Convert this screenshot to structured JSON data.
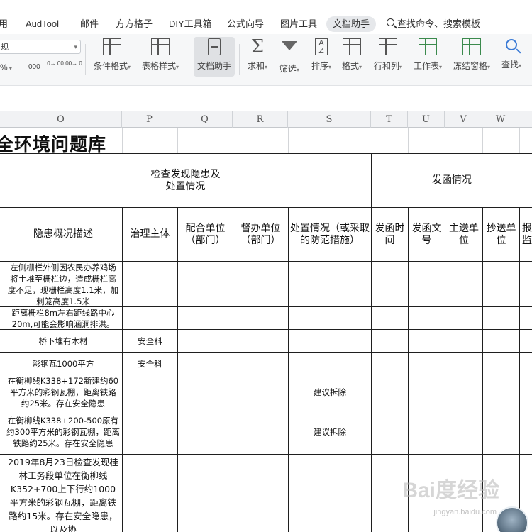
{
  "tabs": [
    {
      "label": "用",
      "x": 0
    },
    {
      "label": "AudTool"
    },
    {
      "label": "邮件"
    },
    {
      "label": "方方格子"
    },
    {
      "label": "DIY工具箱"
    },
    {
      "label": "公式向导"
    },
    {
      "label": "图片工具"
    },
    {
      "label": "文档助手",
      "active": true
    },
    {
      "label": "查找命令、搜索模板"
    }
  ],
  "toolbar": {
    "number_format_value": "规",
    "percent_label": "%",
    "thousands_label": "000",
    "inc_decimal_label": ".0→.00",
    "dec_decimal_label": ".00→.0",
    "tools": [
      {
        "label": "条件格式",
        "icon": "conditional-format-icon"
      },
      {
        "label": "表格样式",
        "icon": "table-style-icon"
      },
      {
        "label": "文档助手",
        "icon": "doc-assistant-icon",
        "active": true
      },
      {
        "label": "求和",
        "icon": "sigma-icon"
      },
      {
        "label": "筛选",
        "icon": "filter-icon"
      },
      {
        "label": "排序",
        "icon": "sort-icon"
      },
      {
        "label": "格式",
        "icon": "format-icon"
      },
      {
        "label": "行和列",
        "icon": "rows-cols-icon"
      },
      {
        "label": "工作表",
        "icon": "worksheet-icon"
      },
      {
        "label": "冻结窗格",
        "icon": "freeze-panes-icon"
      },
      {
        "label": "查找",
        "icon": "find-icon"
      }
    ]
  },
  "columns": [
    "O",
    "P",
    "Q",
    "R",
    "S",
    "T",
    "U",
    "V",
    "W"
  ],
  "sheet": {
    "title": "全环境问题库",
    "group_inspection": "检查发现隐患及\n处置情况",
    "group_letter": "发函情况",
    "headers": {
      "description": "隐患概况描述",
      "owner": "治理主体",
      "coop": "配合单位\n（部门）",
      "supervise": "督办单位\n（部门）",
      "measures": "处置情况（或采取\n的防范措施）",
      "send_time": "发函时\n间",
      "doc_no": "发函文\n号",
      "main_to": "主送单\n位",
      "cc_to": "抄送单\n位",
      "report": "报\n监"
    },
    "rows": [
      {
        "description": "左侧栅栏外侧因农民办养鸡场将土堆至栅栏边，造成栅栏高度不足，现栅栏高度1.1米，加刺笼高度1.5米",
        "owner": "",
        "measures": ""
      },
      {
        "description": "距离栅栏8m左右距线路中心20m,可能会影响涵洞排洪。",
        "owner": "",
        "measures": ""
      },
      {
        "description": "桥下堆有木材",
        "owner": "安全科",
        "measures": ""
      },
      {
        "description": "彩钢瓦1000平方",
        "owner": "安全科",
        "measures": ""
      },
      {
        "description": "在衡柳线K338+172新建约60平方米的彩钢瓦棚，距离铁路约25米。存在安全隐患",
        "owner": "",
        "measures": "建议拆除"
      },
      {
        "description": "在衡柳线K338+200-500原有约300平方米的彩钢瓦棚，距离铁路约25米。存在安全隐患",
        "owner": "",
        "measures": "建议拆除"
      },
      {
        "description": "2019年8月23日检查发现桂林工务段单位在衡柳线K352+700上下行约1000平方米的彩钢瓦棚，距离铁路约15米。存在安全隐患，以及协",
        "owner": "",
        "measures": ""
      }
    ]
  },
  "watermark": {
    "text": "Bai度经验",
    "sub": "jingyan.baidu.com"
  }
}
